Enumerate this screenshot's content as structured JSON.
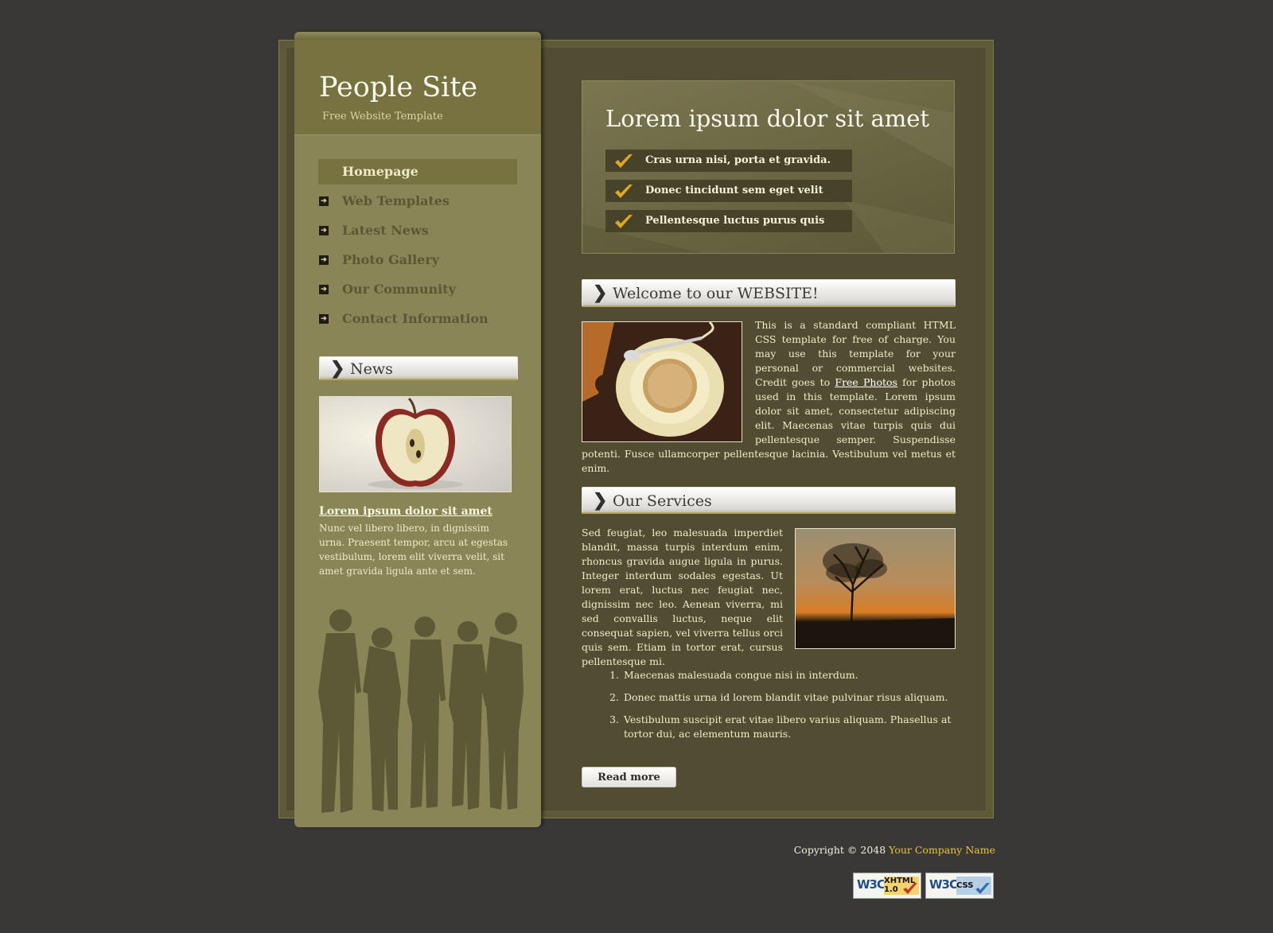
{
  "site": {
    "title": "People Site",
    "tagline": "Free Website Template"
  },
  "nav": {
    "items": [
      {
        "label": "Homepage",
        "active": true
      },
      {
        "label": "Web Templates",
        "active": false
      },
      {
        "label": "Latest News",
        "active": false
      },
      {
        "label": "Photo Gallery",
        "active": false
      },
      {
        "label": "Our Community",
        "active": false
      },
      {
        "label": "Contact Information",
        "active": false
      }
    ]
  },
  "news": {
    "heading": "News",
    "link_text": "Lorem ipsum dolor sit amet",
    "text": "Nunc vel libero libero, in dignissim urna. Praesent tempor, arcu at egestas vestibulum, lorem elit viverra velit, sit amet gravida ligula ante et sem."
  },
  "hero": {
    "title": "Lorem ipsum dolor sit amet",
    "items": [
      "Cras urna nisi, porta et gravida.",
      "Donec tincidunt sem eget velit",
      "Pellentesque luctus purus quis"
    ]
  },
  "welcome": {
    "heading": "Welcome to our WEBSITE!",
    "text_before_link": "This is a standard compliant HTML CSS template for free of charge. You may use this template for your personal or commercial websites. Credit goes to ",
    "link_text": "Free Photos",
    "text_after_link": " for photos used in this template. Lorem ipsum dolor sit amet, consectetur adipiscing elit. Maecenas vitae turpis quis dui pellentesque semper. Suspendisse potenti. Fusce ullamcorper pellentesque lacinia. Vestibulum vel metus et enim."
  },
  "services": {
    "heading": "Our Services",
    "text": "Sed feugiat, leo malesuada imperdiet blandit, massa turpis interdum enim, rhoncus gravida augue ligula in purus. Integer interdum sodales egestas. Ut lorem erat, luctus nec feugiat nec, dignissim nec leo. Aenean viverra, mi sed convallis luctus, neque elit consequat sapien, vel viverra tellus orci quis sem. Etiam in tortor erat, cursus pellentesque mi.",
    "list": [
      "Maecenas malesuada congue nisi in interdum.",
      "Donec mattis urna id lorem blandit vitae pulvinar risus aliquam.",
      "Vestibulum suscipit erat vitae libero varius aliquam. Phasellus at tortor dui, ac elementum mauris."
    ],
    "read_more": "Read more"
  },
  "footer": {
    "copyright": "Copyright © 2048 ",
    "company": "Your Company Name",
    "badge_xhtml": {
      "logo": "W3C",
      "line1": "XHTML",
      "line2": "1.0"
    },
    "badge_css": {
      "logo": "W3C",
      "line1": "CSS",
      "line2": ""
    }
  },
  "colors": {
    "page_bg": "#393836",
    "sidebar": "#8a8556",
    "main": "#524d32",
    "accent_check": "#e0a81e",
    "company_link": "#e8c43a"
  },
  "icons": {
    "nav_bullet": "arrow-right-icon",
    "heading": "chevron-right-icon",
    "hero_bullet": "checkmark-icon"
  }
}
